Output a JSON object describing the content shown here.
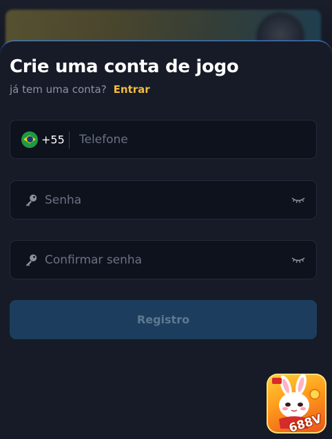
{
  "form": {
    "title": "Crie uma conta de jogo",
    "subtitle": "já tem uma conta?",
    "login_link": "Entrar",
    "phone": {
      "country_flag_icon": "brazil-flag-icon",
      "dial_code": "+55",
      "placeholder": "Telefone"
    },
    "password": {
      "icon": "key-icon",
      "placeholder": "Senha",
      "toggle_icon": "eye-closed-icon"
    },
    "confirm_password": {
      "icon": "key-icon",
      "placeholder": "Confirmar senha",
      "toggle_icon": "eye-closed-icon"
    },
    "submit_label": "Registro"
  },
  "app_badge": {
    "text": "688V"
  },
  "colors": {
    "accent": "#f4bd3a",
    "sheet_border": "#3d7fd6",
    "button_bg": "#1c3d5e"
  }
}
